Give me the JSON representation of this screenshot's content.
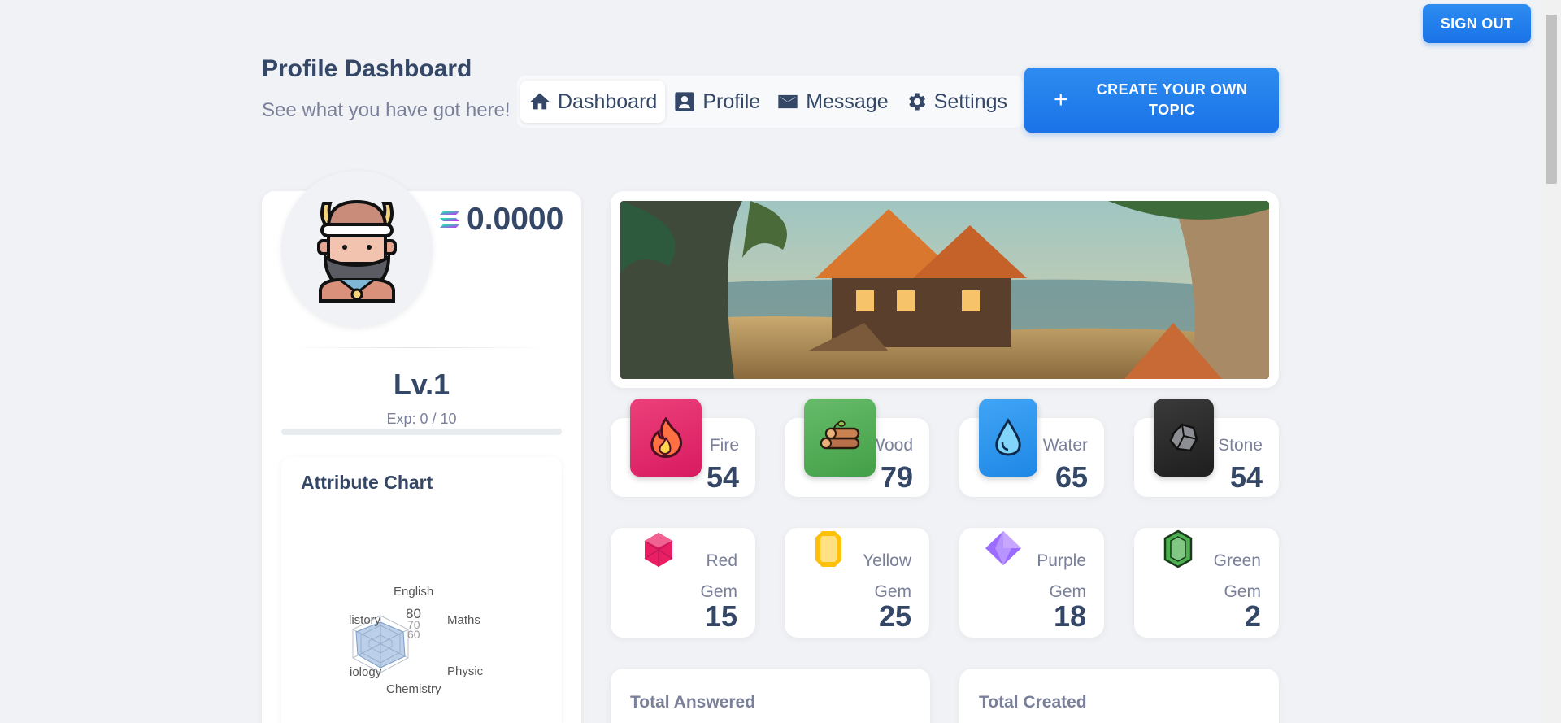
{
  "header": {
    "sign_out_label": "SIGN OUT",
    "title": "Profile Dashboard",
    "subtitle": "See what you have got here!",
    "create_label": "CREATE YOUR OWN TOPIC",
    "create_icon": "+"
  },
  "nav": {
    "tabs": [
      {
        "label": "Dashboard",
        "icon": "home-icon",
        "active": true
      },
      {
        "label": "Profile",
        "icon": "profile-card-icon",
        "active": false
      },
      {
        "label": "Message",
        "icon": "mail-icon",
        "active": false
      },
      {
        "label": "Settings",
        "icon": "gear-icon",
        "active": false
      }
    ]
  },
  "profile": {
    "avatar": "viking-avatar-icon",
    "balance": "0.0000",
    "balance_icon": "solana-icon",
    "level": "Lv.1",
    "exp_text": "Exp: 0 / 10",
    "exp_progress": 0
  },
  "attribute_chart": {
    "title": "Attribute Chart",
    "axes": [
      "English",
      "Maths",
      "Physic",
      "Chemistry",
      "iology",
      "listory"
    ],
    "scale_labels": [
      "80",
      "70",
      "60"
    ]
  },
  "resources": [
    {
      "label": "Fire",
      "value": "54",
      "icon": "fire-icon",
      "color": "#e91e63"
    },
    {
      "label": "Wood",
      "value": "79",
      "icon": "wood-logs-icon",
      "color": "#4caf50"
    },
    {
      "label": "Water",
      "value": "65",
      "icon": "water-drop-icon",
      "color": "#1a73e8"
    },
    {
      "label": "Stone",
      "value": "54",
      "icon": "stone-icon",
      "color": "#2d2d2d"
    }
  ],
  "gems": [
    {
      "label_1": "Red",
      "label_2": "Gem",
      "value": "15",
      "icon": "red-gem-icon",
      "color": "#e91e63"
    },
    {
      "label_1": "Yellow",
      "label_2": "Gem",
      "value": "25",
      "icon": "yellow-gem-icon",
      "color": "#ffc107"
    },
    {
      "label_1": "Purple",
      "label_2": "Gem",
      "value": "18",
      "icon": "purple-gem-icon",
      "color": "#9c6bff"
    },
    {
      "label_1": "Green",
      "label_2": "Gem",
      "value": "2",
      "icon": "green-gem-icon",
      "color": "#4caf50"
    }
  ],
  "totals": {
    "answered_label": "Total Answered",
    "created_label": "Total Created"
  },
  "colors": {
    "accent": "#1a73e8",
    "text": "#344767",
    "muted": "#7b809a",
    "background": "#f0f2f5"
  }
}
